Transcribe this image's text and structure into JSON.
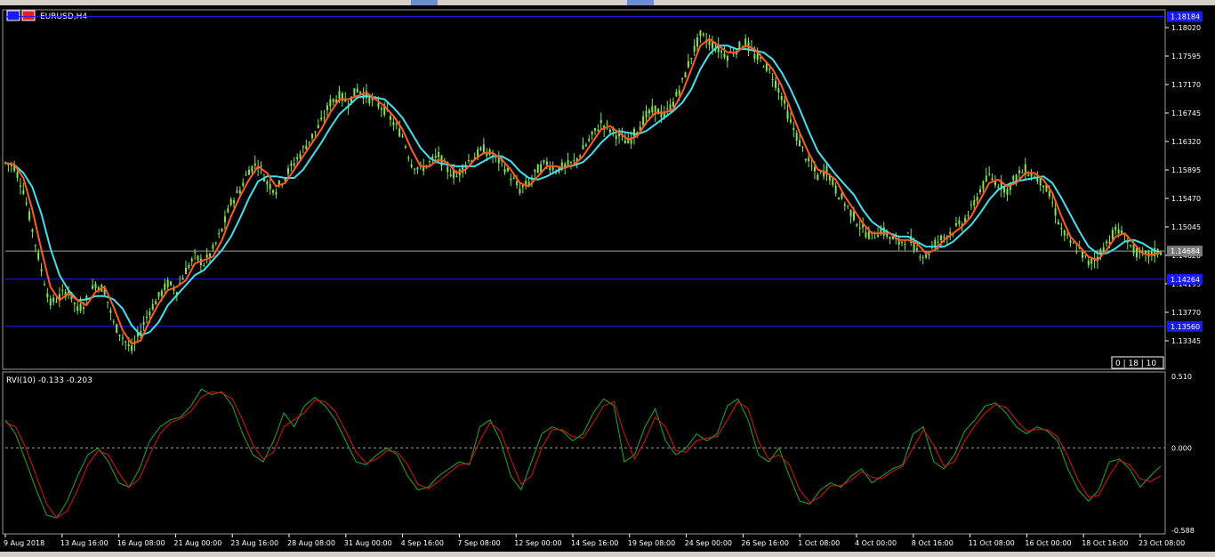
{
  "window": {
    "title": "EURUSD,H4"
  },
  "indicator": {
    "label": "RVI(10) -0.133 -0.203"
  },
  "price_axis": {
    "ticks": [
      "1.18020",
      "1.17595",
      "1.17170",
      "1.16745",
      "1.16320",
      "1.15895",
      "1.15470",
      "1.15045",
      "1.14620",
      "1.14195",
      "1.13770",
      "1.13345"
    ],
    "tags": [
      "1.18184",
      "1.14684",
      "1.14264",
      "1.13560"
    ]
  },
  "rvi_axis": {
    "ticks": [
      "0.510",
      "0.000",
      "-0.588"
    ]
  },
  "time_axis": {
    "ticks": [
      "9 Aug 2018",
      "13 Aug 16:00",
      "16 Aug 08:00",
      "21 Aug 00:00",
      "23 Aug 16:00",
      "28 Aug 08:00",
      "31 Aug 00:00",
      "4 Sep 16:00",
      "7 Sep 08:00",
      "12 Sep 00:00",
      "14 Sep 16:00",
      "19 Sep 08:00",
      "24 Sep 00:00",
      "26 Sep 16:00",
      "1 Oct 08:00",
      "4 Oct 00:00",
      "8 Oct 16:00",
      "11 Oct 08:00",
      "16 Oct 00:00",
      "18 Oct 16:00",
      "23 Oct 08:00"
    ]
  },
  "status_box": {
    "text": "0 | 18 | 10"
  },
  "colors": {
    "background": "#000000",
    "candles": "#7fe650",
    "ma_fast": "#ff5a1e",
    "ma_slow": "#40e0f0",
    "hline": "#1a1aff",
    "price_line": "#a0a0a0",
    "rvi_main": "#1faa1f",
    "rvi_signal": "#e01010",
    "axis_text": "#ffffff",
    "tag_bg": "#1a1aff"
  },
  "chart_data": [
    {
      "type": "line",
      "title": "EURUSD,H4",
      "x_range": [
        "9 Aug 2018",
        "23 Oct 08:00"
      ],
      "ylim": [
        1.131,
        1.183
      ],
      "horizontal_lines": [
        1.18184,
        1.14264,
        1.1356
      ],
      "current_price": 1.14684,
      "series": [
        {
          "values_kind": "price_closes",
          "values": [
            1.16,
            1.1595,
            1.156,
            1.15,
            1.144,
            1.139,
            1.14,
            1.141,
            1.138,
            1.1395,
            1.142,
            1.141,
            1.136,
            1.134,
            1.132,
            1.135,
            1.138,
            1.14,
            1.142,
            1.141,
            1.144,
            1.146,
            1.145,
            1.147,
            1.15,
            1.154,
            1.156,
            1.159,
            1.16,
            1.157,
            1.156,
            1.158,
            1.16,
            1.162,
            1.164,
            1.166,
            1.169,
            1.17,
            1.169,
            1.171,
            1.17,
            1.169,
            1.168,
            1.166,
            1.164,
            1.16,
            1.159,
            1.16,
            1.161,
            1.159,
            1.158,
            1.16,
            1.161,
            1.162,
            1.161,
            1.16,
            1.158,
            1.156,
            1.157,
            1.159,
            1.16,
            1.159,
            1.1595,
            1.16,
            1.162,
            1.164,
            1.166,
            1.165,
            1.164,
            1.163,
            1.165,
            1.167,
            1.168,
            1.167,
            1.169,
            1.172,
            1.176,
            1.179,
            1.178,
            1.177,
            1.176,
            1.177,
            1.178,
            1.176,
            1.175,
            1.173,
            1.17,
            1.166,
            1.163,
            1.16,
            1.158,
            1.159,
            1.156,
            1.154,
            1.152,
            1.15,
            1.149,
            1.15,
            1.149,
            1.148,
            1.149,
            1.147,
            1.146,
            1.148,
            1.149,
            1.15,
            1.151,
            1.153,
            1.156,
            1.158,
            1.157,
            1.156,
            1.158,
            1.159,
            1.158,
            1.157,
            1.154,
            1.15,
            1.148,
            1.147,
            1.145,
            1.146,
            1.148,
            1.15,
            1.149,
            1.147,
            1.146,
            1.1465,
            1.1468
          ]
        },
        {
          "name": "",
          "kind": "ma_fast"
        },
        {
          "name": "",
          "kind": "ma_slow"
        }
      ]
    },
    {
      "type": "line",
      "title": "RVI(10) -0.133 -0.203",
      "ylim": [
        -0.588,
        0.51
      ],
      "zero_line": 0.0,
      "series": [
        {
          "name": "",
          "kind": "rvi_main",
          "values": [
            0.2,
            0.1,
            -0.1,
            -0.3,
            -0.48,
            -0.5,
            -0.38,
            -0.2,
            -0.05,
            0.0,
            -0.1,
            -0.25,
            -0.28,
            -0.15,
            0.05,
            0.15,
            0.2,
            0.22,
            0.3,
            0.42,
            0.38,
            0.4,
            0.3,
            0.1,
            -0.05,
            -0.1,
            0.05,
            0.25,
            0.15,
            0.3,
            0.36,
            0.3,
            0.2,
            0.05,
            -0.1,
            -0.12,
            -0.05,
            0.0,
            -0.05,
            -0.2,
            -0.3,
            -0.28,
            -0.2,
            -0.15,
            -0.1,
            -0.12,
            0.15,
            0.2,
            0.05,
            -0.2,
            -0.3,
            -0.1,
            0.1,
            0.15,
            0.12,
            0.05,
            0.1,
            0.25,
            0.35,
            0.3,
            -0.1,
            -0.05,
            0.15,
            0.28,
            0.05,
            -0.05,
            0.0,
            0.1,
            0.05,
            0.1,
            0.3,
            0.35,
            0.2,
            -0.05,
            -0.1,
            0.0,
            -0.2,
            -0.38,
            -0.4,
            -0.3,
            -0.25,
            -0.28,
            -0.2,
            -0.15,
            -0.25,
            -0.2,
            -0.15,
            -0.12,
            0.1,
            0.15,
            -0.1,
            -0.15,
            -0.05,
            0.12,
            0.2,
            0.3,
            0.32,
            0.25,
            0.15,
            0.1,
            0.15,
            0.12,
            0.05,
            -0.15,
            -0.3,
            -0.38,
            -0.3,
            -0.1,
            -0.08,
            -0.15,
            -0.28,
            -0.2,
            -0.13
          ]
        },
        {
          "name": "",
          "kind": "rvi_signal",
          "values": [
            0.18,
            0.15,
            0.0,
            -0.2,
            -0.4,
            -0.5,
            -0.45,
            -0.3,
            -0.12,
            -0.02,
            -0.05,
            -0.18,
            -0.28,
            -0.22,
            -0.05,
            0.1,
            0.18,
            0.21,
            0.26,
            0.36,
            0.4,
            0.39,
            0.35,
            0.2,
            0.02,
            -0.08,
            -0.03,
            0.15,
            0.2,
            0.25,
            0.34,
            0.33,
            0.26,
            0.12,
            -0.03,
            -0.11,
            -0.08,
            -0.02,
            -0.03,
            -0.12,
            -0.26,
            -0.29,
            -0.24,
            -0.18,
            -0.12,
            -0.11,
            0.05,
            0.18,
            0.12,
            -0.08,
            -0.26,
            -0.2,
            0.0,
            0.13,
            0.13,
            0.08,
            0.07,
            0.18,
            0.3,
            0.33,
            0.1,
            -0.08,
            0.05,
            0.22,
            0.15,
            -0.02,
            -0.03,
            0.05,
            0.07,
            0.08,
            0.2,
            0.33,
            0.28,
            0.05,
            -0.08,
            -0.05,
            -0.12,
            -0.3,
            -0.39,
            -0.35,
            -0.27,
            -0.27,
            -0.23,
            -0.17,
            -0.21,
            -0.22,
            -0.17,
            -0.13,
            0.0,
            0.13,
            0.02,
            -0.13,
            -0.1,
            0.05,
            0.16,
            0.25,
            0.31,
            0.29,
            0.2,
            0.12,
            0.13,
            0.13,
            0.08,
            -0.06,
            -0.23,
            -0.35,
            -0.34,
            -0.2,
            -0.09,
            -0.12,
            -0.22,
            -0.24,
            -0.2
          ]
        }
      ]
    }
  ]
}
